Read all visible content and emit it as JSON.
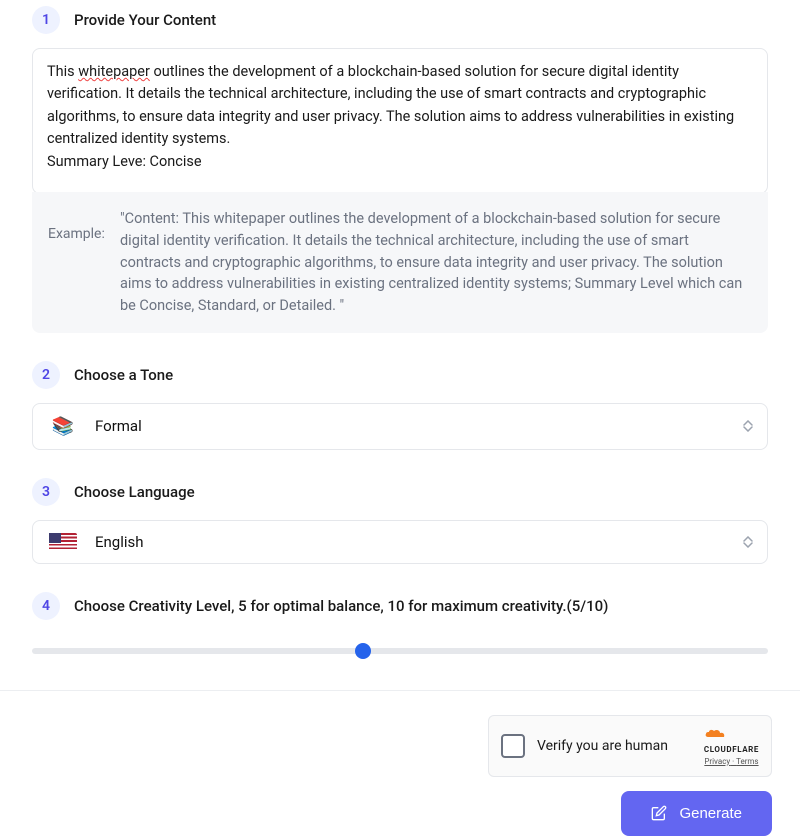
{
  "steps": {
    "s1": {
      "num": "1",
      "title": "Provide Your Content"
    },
    "s2": {
      "num": "2",
      "title": "Choose a Tone"
    },
    "s3": {
      "num": "3",
      "title": "Choose Language"
    },
    "s4": {
      "num": "4",
      "title": "Choose Creativity Level, 5 for optimal balance, 10 for maximum creativity.(5/10)"
    }
  },
  "content": {
    "text_line1_a": "This ",
    "text_line1_word": "whitepaper",
    "text_line1_b": " outlines the development of a blockchain-based solution for secure digital identity verification. It details the technical architecture, including the use of smart contracts and cryptographic algorithms, to ensure data integrity and user privacy. The solution aims to address vulnerabilities in existing centralized identity systems.",
    "text_line2": "Summary Leve: Concise"
  },
  "example": {
    "label": "Example:",
    "text": "\"Content: This whitepaper outlines the development of a blockchain-based solution for secure digital identity verification. It details the technical architecture, including the use of smart contracts and cryptographic algorithms, to ensure data integrity and user privacy. The solution aims to address vulnerabilities in existing centralized identity systems; Summary Level which can be Concise, Standard, or Detailed. \""
  },
  "tone": {
    "selected": "Formal",
    "icon": "books-icon"
  },
  "language": {
    "selected": "English",
    "icon": "flag-us-icon"
  },
  "creativity": {
    "value": 5,
    "min": 0,
    "max": 10,
    "percent": 45
  },
  "captcha": {
    "label": "Verify you are human",
    "brand": "CLOUDFLARE",
    "privacy": "Privacy",
    "terms": "Terms",
    "sep": " · "
  },
  "actions": {
    "generate": "Generate"
  }
}
